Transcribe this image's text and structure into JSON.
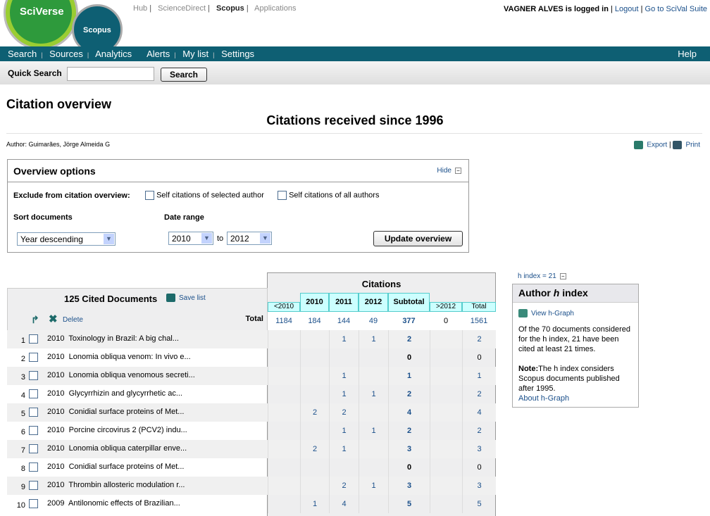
{
  "logo": {
    "brand": "SciVerse",
    "product": "Scopus"
  },
  "top_links": [
    "Hub",
    "ScienceDirect",
    "Scopus",
    "Applications"
  ],
  "user": {
    "logged_in": "VAGNER ALVES is logged in",
    "logout": "Logout",
    "scival": "Go to SciVal Suite"
  },
  "nav": {
    "items": [
      "Search",
      "Sources",
      "Analytics",
      "Alerts",
      "My list",
      "Settings"
    ],
    "help": "Help"
  },
  "quick_search": {
    "label": "Quick Search",
    "value": "",
    "button": "Search"
  },
  "page": {
    "title": "Citation overview",
    "subtitle": "Citations received since 1996",
    "author": "Author:  Guimarães, Jörge Almeida G",
    "export": "Export",
    "print": "Print"
  },
  "options": {
    "title": "Overview options",
    "hide": "Hide",
    "exclude_label": "Exclude from citation overview:",
    "self_selected": "Self citations of selected author",
    "self_all": "Self citations of all authors",
    "sort_label": "Sort documents",
    "sort_value": "Year descending",
    "date_label": "Date range",
    "from": "2010",
    "to_word": "to",
    "to": "2012",
    "update": "Update overview"
  },
  "table": {
    "cited": "125 Cited Documents",
    "save_list": "Save list",
    "delete": "Delete",
    "total_label": "Total",
    "citations_header": "Citations",
    "columns": [
      "<2010",
      "2010",
      "2011",
      "2012",
      "Subtotal",
      ">2012",
      "Total"
    ],
    "totals": [
      "1184",
      "184",
      "144",
      "49",
      "377",
      "0",
      "1561"
    ],
    "rows": [
      {
        "n": "1",
        "year": "2010",
        "title": "Toxinology in Brazil: A big chal...",
        "v": [
          "",
          "",
          "1",
          "1",
          "2",
          "",
          "2"
        ]
      },
      {
        "n": "2",
        "year": "2010",
        "title": "Lonomia obliqua venom: In vivo e...",
        "v": [
          "",
          "",
          "",
          "",
          "0",
          "",
          "0"
        ]
      },
      {
        "n": "3",
        "year": "2010",
        "title": "Lonomia obliqua venomous secreti...",
        "v": [
          "",
          "",
          "1",
          "",
          "1",
          "",
          "1"
        ]
      },
      {
        "n": "4",
        "year": "2010",
        "title": "Glycyrrhizin and glycyrrhetic ac...",
        "v": [
          "",
          "",
          "1",
          "1",
          "2",
          "",
          "2"
        ]
      },
      {
        "n": "5",
        "year": "2010",
        "title": "Conidial surface proteins of Met...",
        "v": [
          "",
          "2",
          "2",
          "",
          "4",
          "",
          "4"
        ]
      },
      {
        "n": "6",
        "year": "2010",
        "title": "Porcine circovirus 2 (PCV2) indu...",
        "v": [
          "",
          "",
          "1",
          "1",
          "2",
          "",
          "2"
        ]
      },
      {
        "n": "7",
        "year": "2010",
        "title": "Lonomia obliqua caterpillar enve...",
        "v": [
          "",
          "2",
          "1",
          "",
          "3",
          "",
          "3"
        ]
      },
      {
        "n": "8",
        "year": "2010",
        "title": "Conidial surface proteins of Met...",
        "v": [
          "",
          "",
          "",
          "",
          "0",
          "",
          "0"
        ]
      },
      {
        "n": "9",
        "year": "2010",
        "title": "Thrombin allosteric modulation r...",
        "v": [
          "",
          "",
          "2",
          "1",
          "3",
          "",
          "3"
        ]
      },
      {
        "n": "10",
        "year": "2009",
        "title": "Antilonomic effects of Brazilian...",
        "v": [
          "",
          "1",
          "4",
          "",
          "5",
          "",
          "5"
        ]
      }
    ]
  },
  "hindex": {
    "link": "h index = 21",
    "title_pre": "Author ",
    "title_h": "h",
    "title_post": " index",
    "view": "View h-Graph",
    "text1": "Of the 70 documents considered for the h index, 21 have been cited at least 21 times.",
    "note_label": "Note:",
    "note": "The h index considers Scopus documents published after 1995.",
    "about": "About h-Graph"
  }
}
